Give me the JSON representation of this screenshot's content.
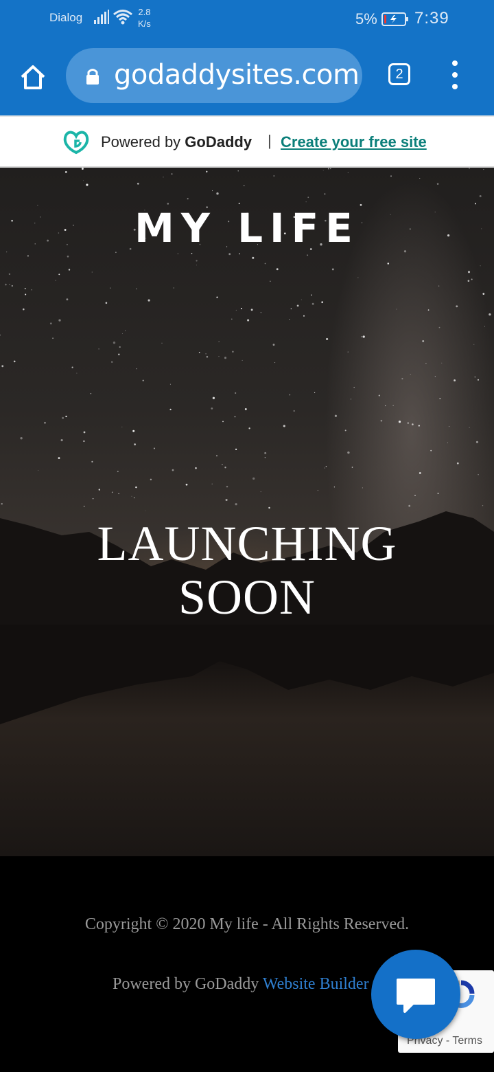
{
  "status_bar": {
    "carrier": "Dialog",
    "speed_value": "2.8",
    "speed_unit": "K/s",
    "battery_percent": "5%",
    "time": "7:39"
  },
  "browser": {
    "url": "godaddysites.com",
    "tab_count": "2"
  },
  "banner": {
    "powered_prefix": "Powered by ",
    "brand": "GoDaddy",
    "separator": "|",
    "create_link": "Create your free site",
    "accent_color": "#0b7f7a"
  },
  "hero": {
    "site_title": "MY LIFE",
    "headline_line1": "LAUNCHING",
    "headline_line2": "SOON"
  },
  "footer": {
    "copyright": "Copyright © 2020 My life - All Rights Reserved.",
    "powered_text": "Powered by GoDaddy ",
    "builder_link": "Website Builder"
  },
  "recaptcha": {
    "links": "Privacy - Terms"
  },
  "colors": {
    "browser_bar": "#1473c7",
    "chat_button": "#1470c8"
  },
  "icons": {
    "home": "home-icon",
    "lock": "lock-icon",
    "menu": "more-vert-icon",
    "chat": "chat-bubble-icon"
  }
}
